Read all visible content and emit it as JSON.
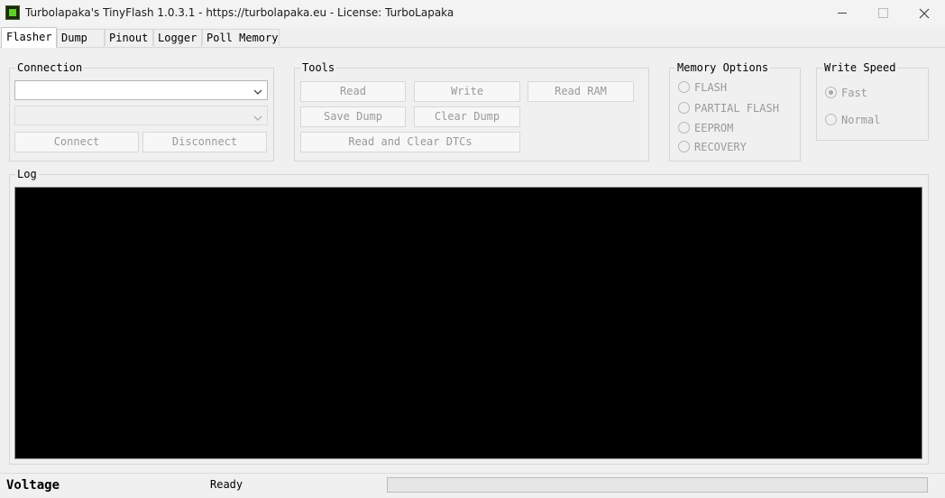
{
  "window": {
    "title": "Turbolapaka's TinyFlash 1.0.3.1 - https://turbolapaka.eu - License: TurboLapaka"
  },
  "tabs": [
    "Flasher",
    "Dump",
    "Pinout",
    "Logger",
    "Poll Memory"
  ],
  "connection": {
    "legend": "Connection",
    "port_value": "",
    "device_value": "",
    "connect_label": "Connect",
    "disconnect_label": "Disconnect"
  },
  "tools": {
    "legend": "Tools",
    "read_label": "Read",
    "write_label": "Write",
    "read_ram_label": "Read RAM",
    "save_dump_label": "Save Dump",
    "clear_dump_label": "Clear Dump",
    "read_clear_dtcs_label": "Read and Clear DTCs"
  },
  "memory_options": {
    "legend": "Memory Options",
    "options": [
      "FLASH",
      "PARTIAL FLASH",
      "EEPROM",
      "RECOVERY"
    ]
  },
  "write_speed": {
    "legend": "Write Speed",
    "options": [
      "Fast",
      "Normal"
    ],
    "selected": "Fast"
  },
  "log": {
    "legend": "Log"
  },
  "status": {
    "voltage_label": "Voltage",
    "status_text": "Ready",
    "progress": 0
  },
  "colors": {
    "log_background": "#000000",
    "window_background": "#f0f0f0"
  }
}
